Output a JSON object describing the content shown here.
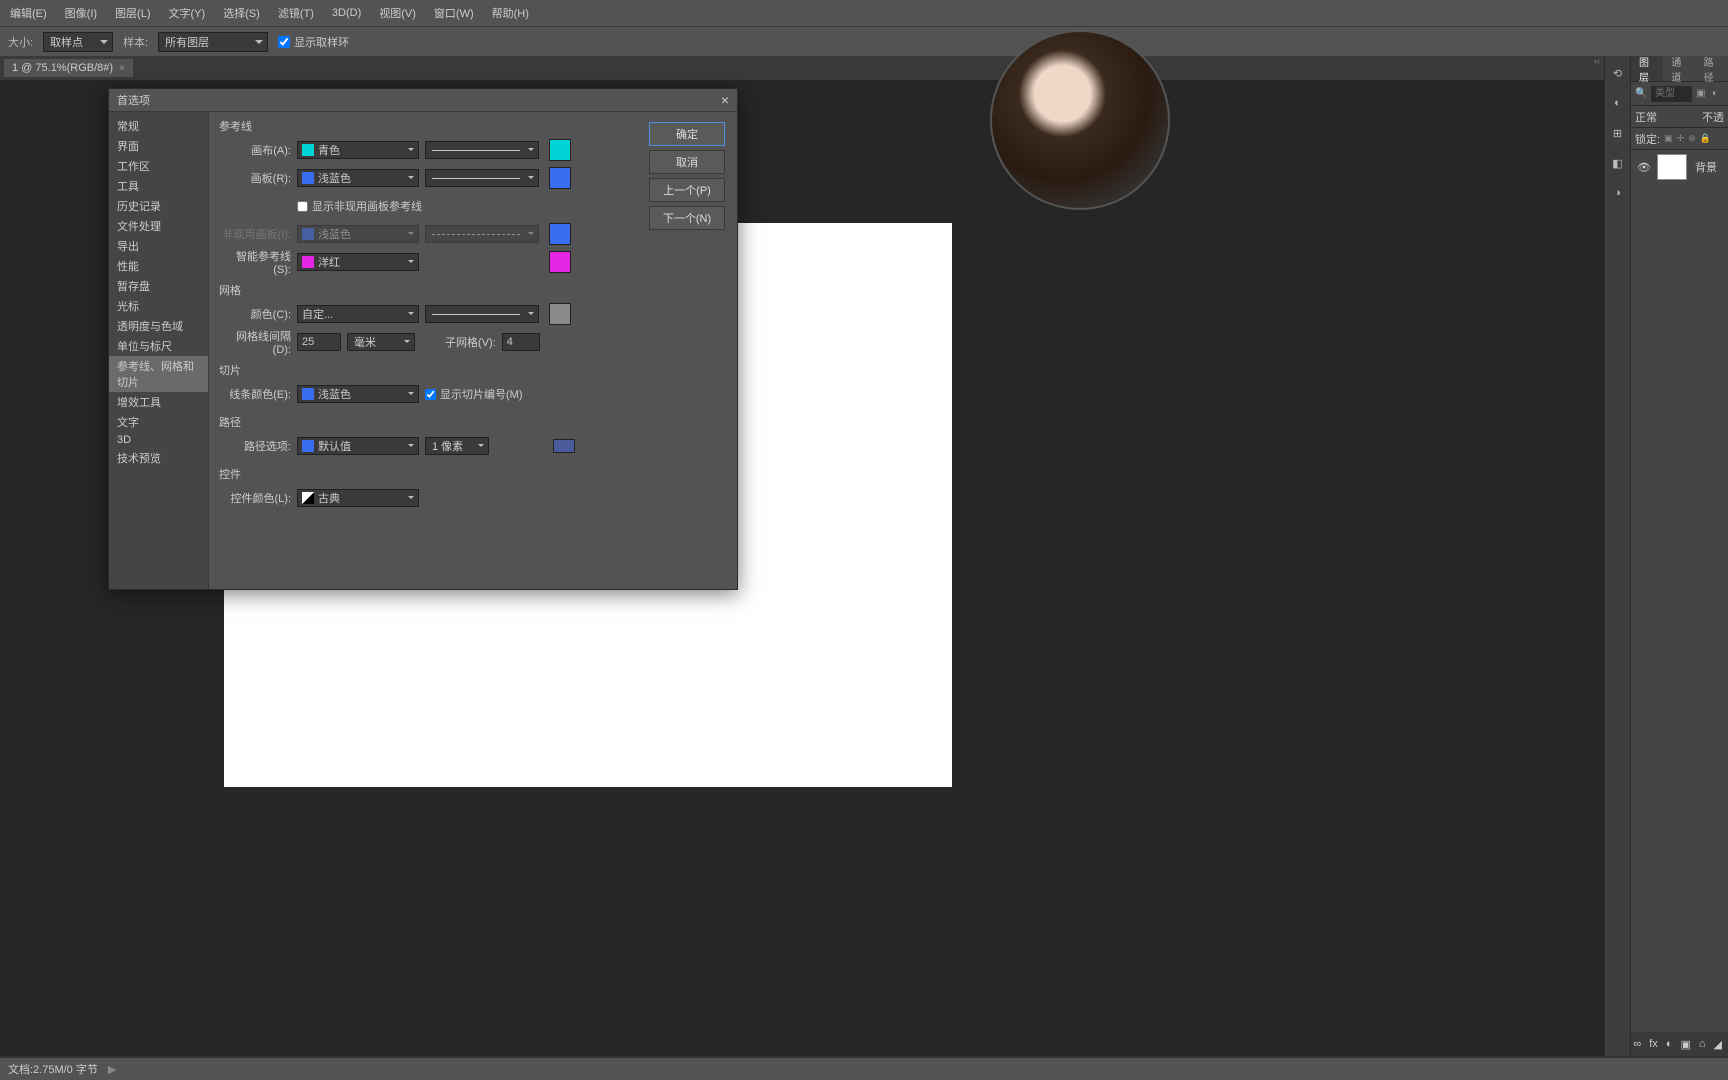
{
  "menu": [
    "编辑(E)",
    "图像(I)",
    "图层(L)",
    "文字(Y)",
    "选择(S)",
    "滤镜(T)",
    "3D(D)",
    "视图(V)",
    "窗口(W)",
    "帮助(H)"
  ],
  "optbar": {
    "size_lbl": "大小:",
    "size_val": "取样点",
    "sample_lbl": "样本:",
    "sample_val": "所有图层",
    "ring_chk": "显示取样环"
  },
  "tab": {
    "name": "1 @ 75.1%(RGB/8#)",
    "close": "×"
  },
  "status": {
    "doc": "文档:2.75M/0 字节"
  },
  "panels": {
    "tabs": [
      "图层",
      "通道",
      "路径"
    ],
    "search_ph": "类型",
    "blend": "正常",
    "opacity_suffix": "不透",
    "lock": "锁定:",
    "layer": {
      "name": "背景"
    },
    "foot": [
      "∞",
      "fx",
      "◐",
      "▣",
      "⌂",
      "◢"
    ]
  },
  "collapse": "‹‹",
  "dialog": {
    "title": "首选项",
    "close": "×",
    "side": [
      "常规",
      "界面",
      "工作区",
      "工具",
      "历史记录",
      "文件处理",
      "导出",
      "性能",
      "暂存盘",
      "光标",
      "透明度与色域",
      "单位与标尺",
      "参考线、网格和切片",
      "增效工具",
      "文字",
      "3D",
      "技术预览"
    ],
    "btns": {
      "ok": "确定",
      "cancel": "取消",
      "prev": "上一个(P)",
      "next": "下一个(N)"
    },
    "guides": {
      "h": "参考线",
      "canvas_lbl": "画布(A):",
      "canvas_val": "青色",
      "canvas_color": "#00d4d4",
      "artboard_lbl": "画板(R):",
      "artboard_val": "浅蓝色",
      "artboard_color": "#3a6cf0",
      "inactive_chk": "显示非现用画板参考线",
      "inactive_lbl": "非现用画板(I):",
      "inactive_val": "浅蓝色",
      "inactive_color": "#3a6cf0",
      "smart_lbl": "智能参考线(S):",
      "smart_val": "洋红",
      "smart_color": "#e426e4"
    },
    "grid": {
      "h": "网格",
      "color_lbl": "颜色(C):",
      "color_val": "自定...",
      "swatch": "#8a8a8a",
      "every_lbl": "网格线间隔(D):",
      "every_val": "25",
      "unit": "毫米",
      "sub_lbl": "子网格(V):",
      "sub_val": "4"
    },
    "slice": {
      "h": "切片",
      "color_lbl": "线条颜色(E):",
      "color_val": "浅蓝色",
      "color": "#3a6cf0",
      "num_chk": "显示切片编号(M)"
    },
    "path": {
      "h": "路径",
      "opt_lbl": "路径选项:",
      "opt_val": "默认值",
      "opt_color": "#3a6cf0",
      "thick": "1 像素",
      "swatch": "#4a5a9a"
    },
    "ctrl": {
      "h": "控件",
      "color_lbl": "控件颜色(L):",
      "color_val": "古典"
    }
  }
}
